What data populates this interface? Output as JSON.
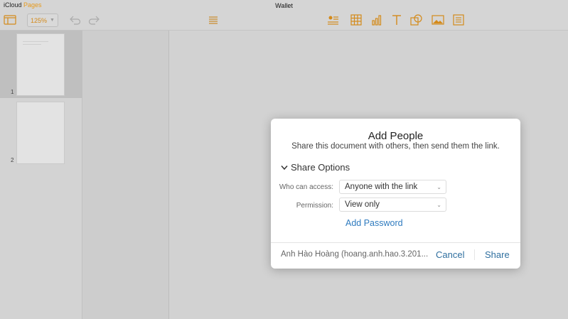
{
  "app": {
    "brand": "iCloud",
    "brand_product": "Pages",
    "document_title": "Wallet"
  },
  "toolbar": {
    "zoom_value": "125%",
    "left_icons": [
      "view-icon",
      "undo-icon",
      "redo-icon"
    ],
    "center_icons": [
      "list-icon"
    ],
    "right_icons": [
      "comment-icon",
      "table-icon",
      "chart-icon",
      "text-icon",
      "shape-icon",
      "media-icon",
      "format-icon"
    ],
    "accent_color": "#e69a1d"
  },
  "sidebar": {
    "pages": [
      {
        "number": "1",
        "selected": true
      },
      {
        "number": "2",
        "selected": false
      }
    ]
  },
  "dialog": {
    "title": "Add People",
    "subtitle": "Share this document with others, then send them the link.",
    "share_options_label": "Share Options",
    "who_label": "Who can access:",
    "who_value": "Anyone with the link",
    "permission_label": "Permission:",
    "permission_value": "View only",
    "add_password": "Add Password",
    "user": "Anh Hào Hoàng (hoang.anh.hao.3.201...",
    "cancel": "Cancel",
    "share": "Share",
    "link_color": "#2f7bbf"
  }
}
